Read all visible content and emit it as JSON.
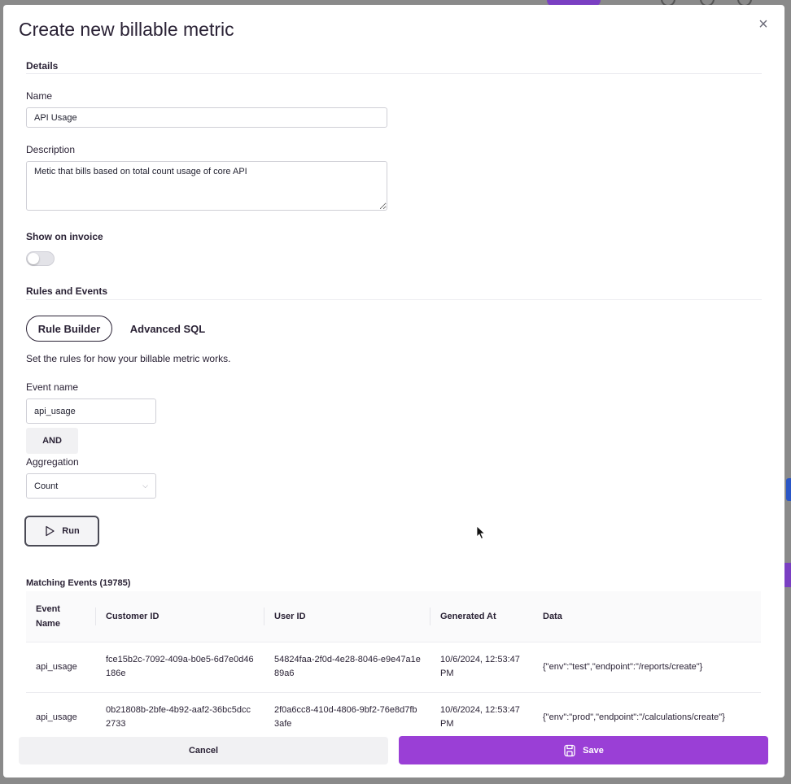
{
  "modal": {
    "title": "Create new billable metric",
    "close_glyph": "×"
  },
  "details": {
    "section_title": "Details",
    "name_label": "Name",
    "name_value": "API Usage",
    "description_label": "Description",
    "description_value": "Metic that bills based on total count usage of core API",
    "show_on_invoice_label": "Show on invoice",
    "show_on_invoice": false
  },
  "rules": {
    "section_title": "Rules and Events",
    "tabs": [
      {
        "label": "Rule Builder",
        "active": true
      },
      {
        "label": "Advanced SQL",
        "active": false
      }
    ],
    "help_text": "Set the rules for how your billable metric works.",
    "event_name_label": "Event name",
    "event_name_value": "api_usage",
    "and_label": "AND",
    "aggregation_label": "Aggregation",
    "aggregation_value": "Count",
    "run_label": "Run"
  },
  "matching": {
    "title": "Matching Events (19785)",
    "columns": [
      "Event\nName",
      "Customer ID",
      "User ID",
      "Generated At",
      "Data"
    ],
    "rows": [
      {
        "event_name": "api_usage",
        "customer_id": "fce15b2c-7092-409a-b0e5-6d7e0d46186e",
        "user_id": "54824faa-2f0d-4e28-8046-e9e47a1e89a6",
        "generated_at": "10/6/2024, 12:53:47 PM",
        "data": "{\"env\":\"test\",\"endpoint\":\"/reports/create\"}"
      },
      {
        "event_name": "api_usage",
        "customer_id": "0b21808b-2bfe-4b92-aaf2-36bc5dcc2733",
        "user_id": "2f0a6cc8-410d-4806-9bf2-76e8d7fb3afe",
        "generated_at": "10/6/2024, 12:53:47 PM",
        "data": "{\"env\":\"prod\",\"endpoint\":\"/calculations/create\"}"
      }
    ]
  },
  "footer": {
    "cancel_label": "Cancel",
    "save_label": "Save"
  },
  "colors": {
    "accent": "#9a3fd6",
    "text": "#2a2235"
  }
}
